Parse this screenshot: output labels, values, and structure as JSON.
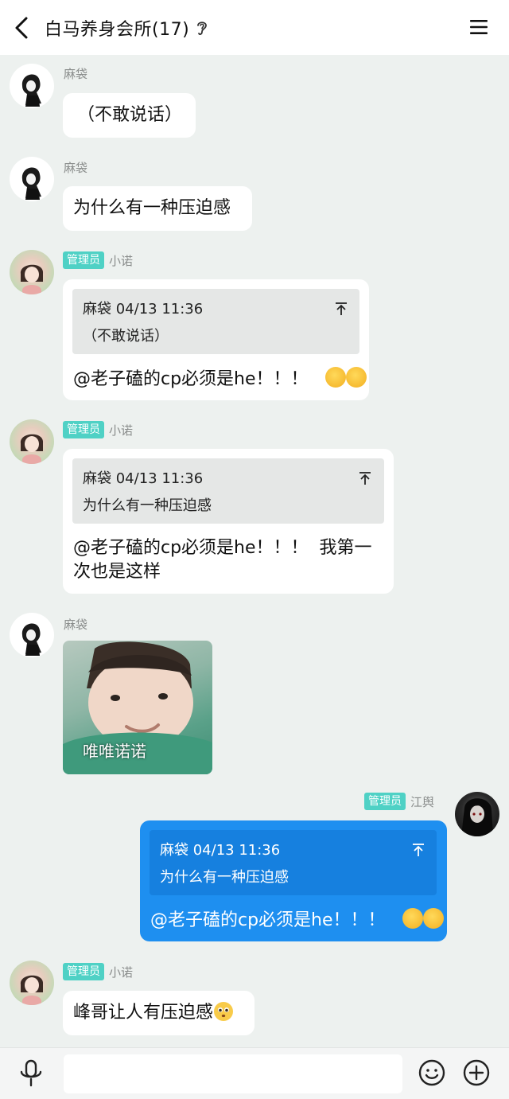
{
  "header": {
    "title": "白马养身会所(17)",
    "back_icon": "chevron-left-icon",
    "ear_icon": "ear-icon",
    "menu_icon": "hamburger-menu-icon"
  },
  "messages": [
    {
      "sender": "麻袋",
      "text": "（不敢说话）"
    },
    {
      "sender": "麻袋",
      "text": "为什么有一种压迫感"
    },
    {
      "badge": "管理员",
      "sender": "小诺",
      "quote": {
        "author": "麻袋",
        "time": "04/13 11:36",
        "text": "（不敢说话）"
      },
      "text": "@老子磕的cp必须是he！！！"
    },
    {
      "badge": "管理员",
      "sender": "小诺",
      "quote": {
        "author": "麻袋",
        "time": "04/13 11:36",
        "text": "为什么有一种压迫感"
      },
      "text_line1": "@老子磕的cp必须是he！！！  我第一",
      "text_line2": "次也是这样"
    },
    {
      "sender": "麻袋",
      "sticker_caption": "唯唯诺诺"
    },
    {
      "badge": "管理员",
      "sender": "江舆",
      "quote": {
        "author": "麻袋",
        "time": "04/13 11:36",
        "text": "为什么有一种压迫感"
      },
      "text": "@老子磕的cp必须是he！！！"
    },
    {
      "badge": "管理员",
      "sender": "小诺",
      "text": "峰哥让人有压迫感"
    }
  ],
  "input_bar": {
    "mic_icon": "microphone-icon",
    "emoji_icon": "smiley-icon",
    "plus_icon": "plus-circle-icon",
    "placeholder": ""
  },
  "colors": {
    "background": "#edf1ef",
    "self_bubble": "#1e8ff0",
    "admin_badge": "#4fd1c5"
  }
}
